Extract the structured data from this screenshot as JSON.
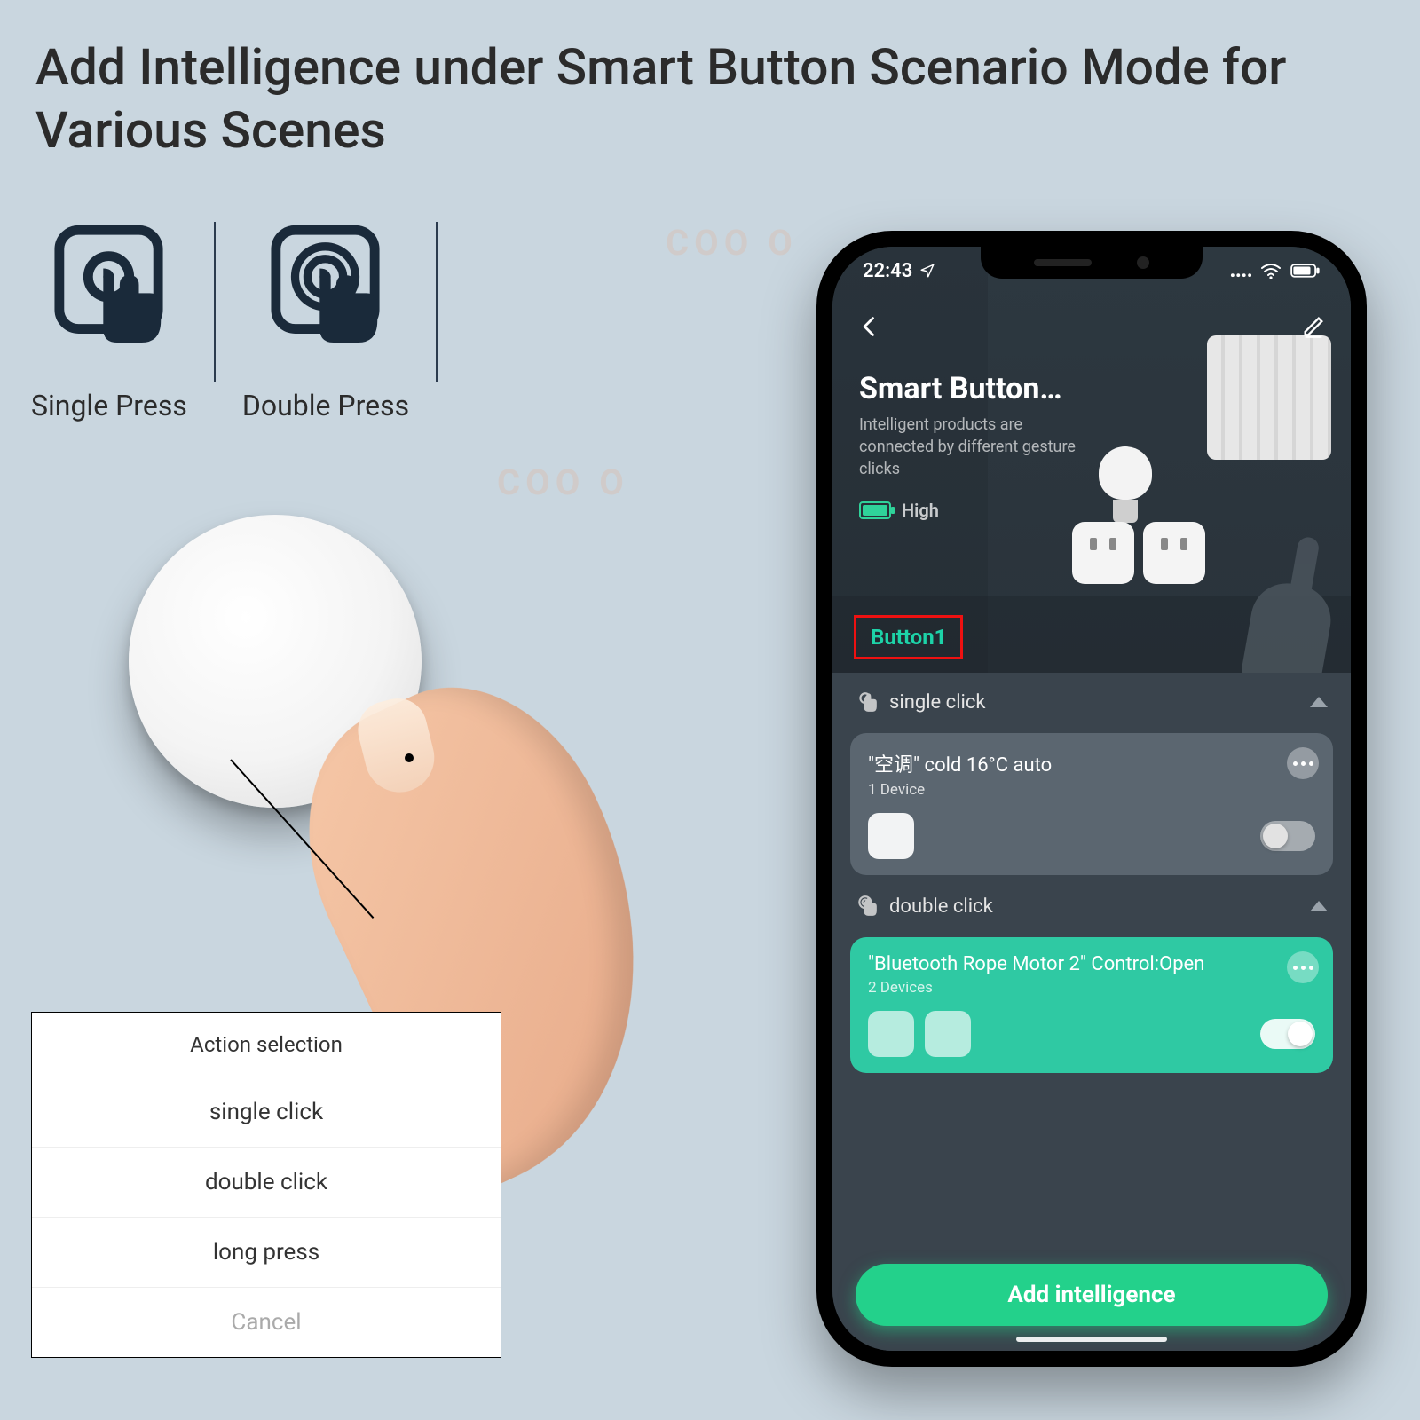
{
  "headline": "Add Intelligence under Smart Button Scenario Mode for Various Scenes",
  "presses": {
    "single": "Single Press",
    "double": "Double Press"
  },
  "sheet": {
    "title": "Action selection",
    "options": [
      "single click",
      "double click",
      "long press"
    ],
    "cancel": "Cancel"
  },
  "phone": {
    "status": {
      "time": "22:43"
    },
    "header": {
      "title": "Smart Button…",
      "subtitle": "Intelligent products are connected by different gesture clicks",
      "battery_label": "High"
    },
    "tab": "Button1",
    "sections": {
      "single": {
        "label": "single click",
        "card": {
          "title": "\"空调\" cold 16°C auto",
          "sub": "1 Device",
          "toggle": "off"
        }
      },
      "double": {
        "label": "double click",
        "card": {
          "title": "\"Bluetooth Rope Motor 2\" Control:Open",
          "sub": "2 Devices",
          "toggle": "on"
        }
      }
    },
    "cta": "Add intelligence"
  },
  "watermark": "COO O"
}
